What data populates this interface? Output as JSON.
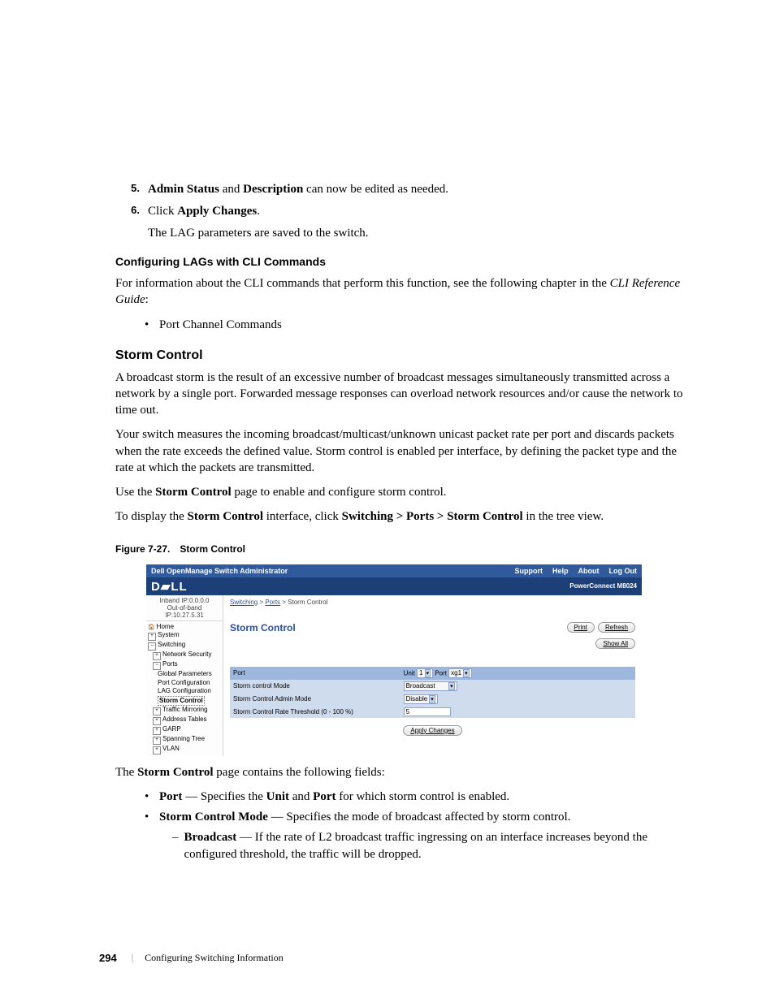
{
  "step5": {
    "num": "5.",
    "t1": "Admin Status",
    "t2": " and ",
    "t3": "Description",
    "t4": " can now be edited as needed."
  },
  "step6": {
    "num": "6.",
    "t1": "Click ",
    "t2": "Apply Changes",
    "t3": ".",
    "follow": "The LAG parameters are saved to the switch."
  },
  "cfg_head": "Configuring LAGs with CLI Commands",
  "cfg_para_a": "For information about the CLI commands that perform this function, see the following chapter in the ",
  "cfg_para_b": "CLI Reference Guide",
  "cfg_para_c": ":",
  "cfg_bullet": "Port Channel Commands",
  "storm_head": "Storm Control",
  "storm_p1": "A broadcast storm is the result of an excessive number of broadcast messages simultaneously transmitted across a network by a single port. Forwarded message responses can overload network resources and/or cause the network to time out.",
  "storm_p2": "Your switch measures the incoming broadcast/multicast/unknown unicast packet rate per port and discards packets when the rate exceeds the defined value. Storm control is enabled per interface, by defining the packet type and the rate at which the packets are transmitted.",
  "storm_p3a": "Use the ",
  "storm_p3b": "Storm Control",
  "storm_p3c": " page to enable and configure storm control.",
  "storm_p4a": "To display the ",
  "storm_p4b": "Storm Control",
  "storm_p4c": " interface, click ",
  "storm_p4d": "Switching > Ports > Storm Control",
  "storm_p4e": " in the tree view.",
  "fig_a": "Figure 7-27.",
  "fig_b": "Storm Control",
  "shot": {
    "title": "Dell OpenManage Switch Administrator",
    "links": {
      "support": "Support",
      "help": "Help",
      "about": "About",
      "logout": "Log Out"
    },
    "brand": "D▰LL",
    "model": "PowerConnect M8024",
    "ip1": "Inband IP:0.0.0.0",
    "ip2": "Out-of-band IP:10.27.5.31",
    "tree": {
      "home": "Home",
      "system": "System",
      "switching": "Switching",
      "netsec": "Network Security",
      "ports": "Ports",
      "gp": "Global Parameters",
      "pc": "Port Configuration",
      "lag": "LAG Configuration",
      "storm": "Storm Control",
      "tm": "Traffic Mirroring",
      "at": "Address Tables",
      "garp": "GARP",
      "st": "Spanning Tree",
      "vlan": "VLAN"
    },
    "crumb": {
      "a": "Switching",
      "b": "Ports",
      "c": " > Storm Control"
    },
    "panel_title": "Storm Control",
    "btn_print": "Print",
    "btn_refresh": "Refresh",
    "btn_showall": "Show All",
    "table": {
      "r1a": "Port",
      "r1b_unit": "Unit",
      "r1b_port": "Port",
      "r1b_uval": "1",
      "r1b_pval": "xg1",
      "r2a": "Storm control Mode",
      "r2b": "Broadcast",
      "r3a": "Storm Control Admin Mode",
      "r3b": "Disable",
      "r4a": "Storm Control Rate Threshold (0 - 100 %)",
      "r4b": "5"
    },
    "apply": "Apply Changes"
  },
  "after1a": "The ",
  "after1b": "Storm Control",
  "after1c": " page contains the following fields:",
  "bul_port_a": "Port",
  "bul_port_b": " — Specifies the ",
  "bul_port_c": "Unit",
  "bul_port_d": " and ",
  "bul_port_e": "Port",
  "bul_port_f": " for which storm control is enabled.",
  "bul_scm_a": "Storm Control Mode",
  "bul_scm_b": " — Specifies the mode of broadcast affected by storm control.",
  "dash_a": "Broadcast",
  "dash_b": " — If the rate of L2 broadcast traffic ingressing on an interface increases beyond the configured threshold, the traffic will be dropped.",
  "footer_page": "294",
  "footer_title": "Configuring Switching Information"
}
